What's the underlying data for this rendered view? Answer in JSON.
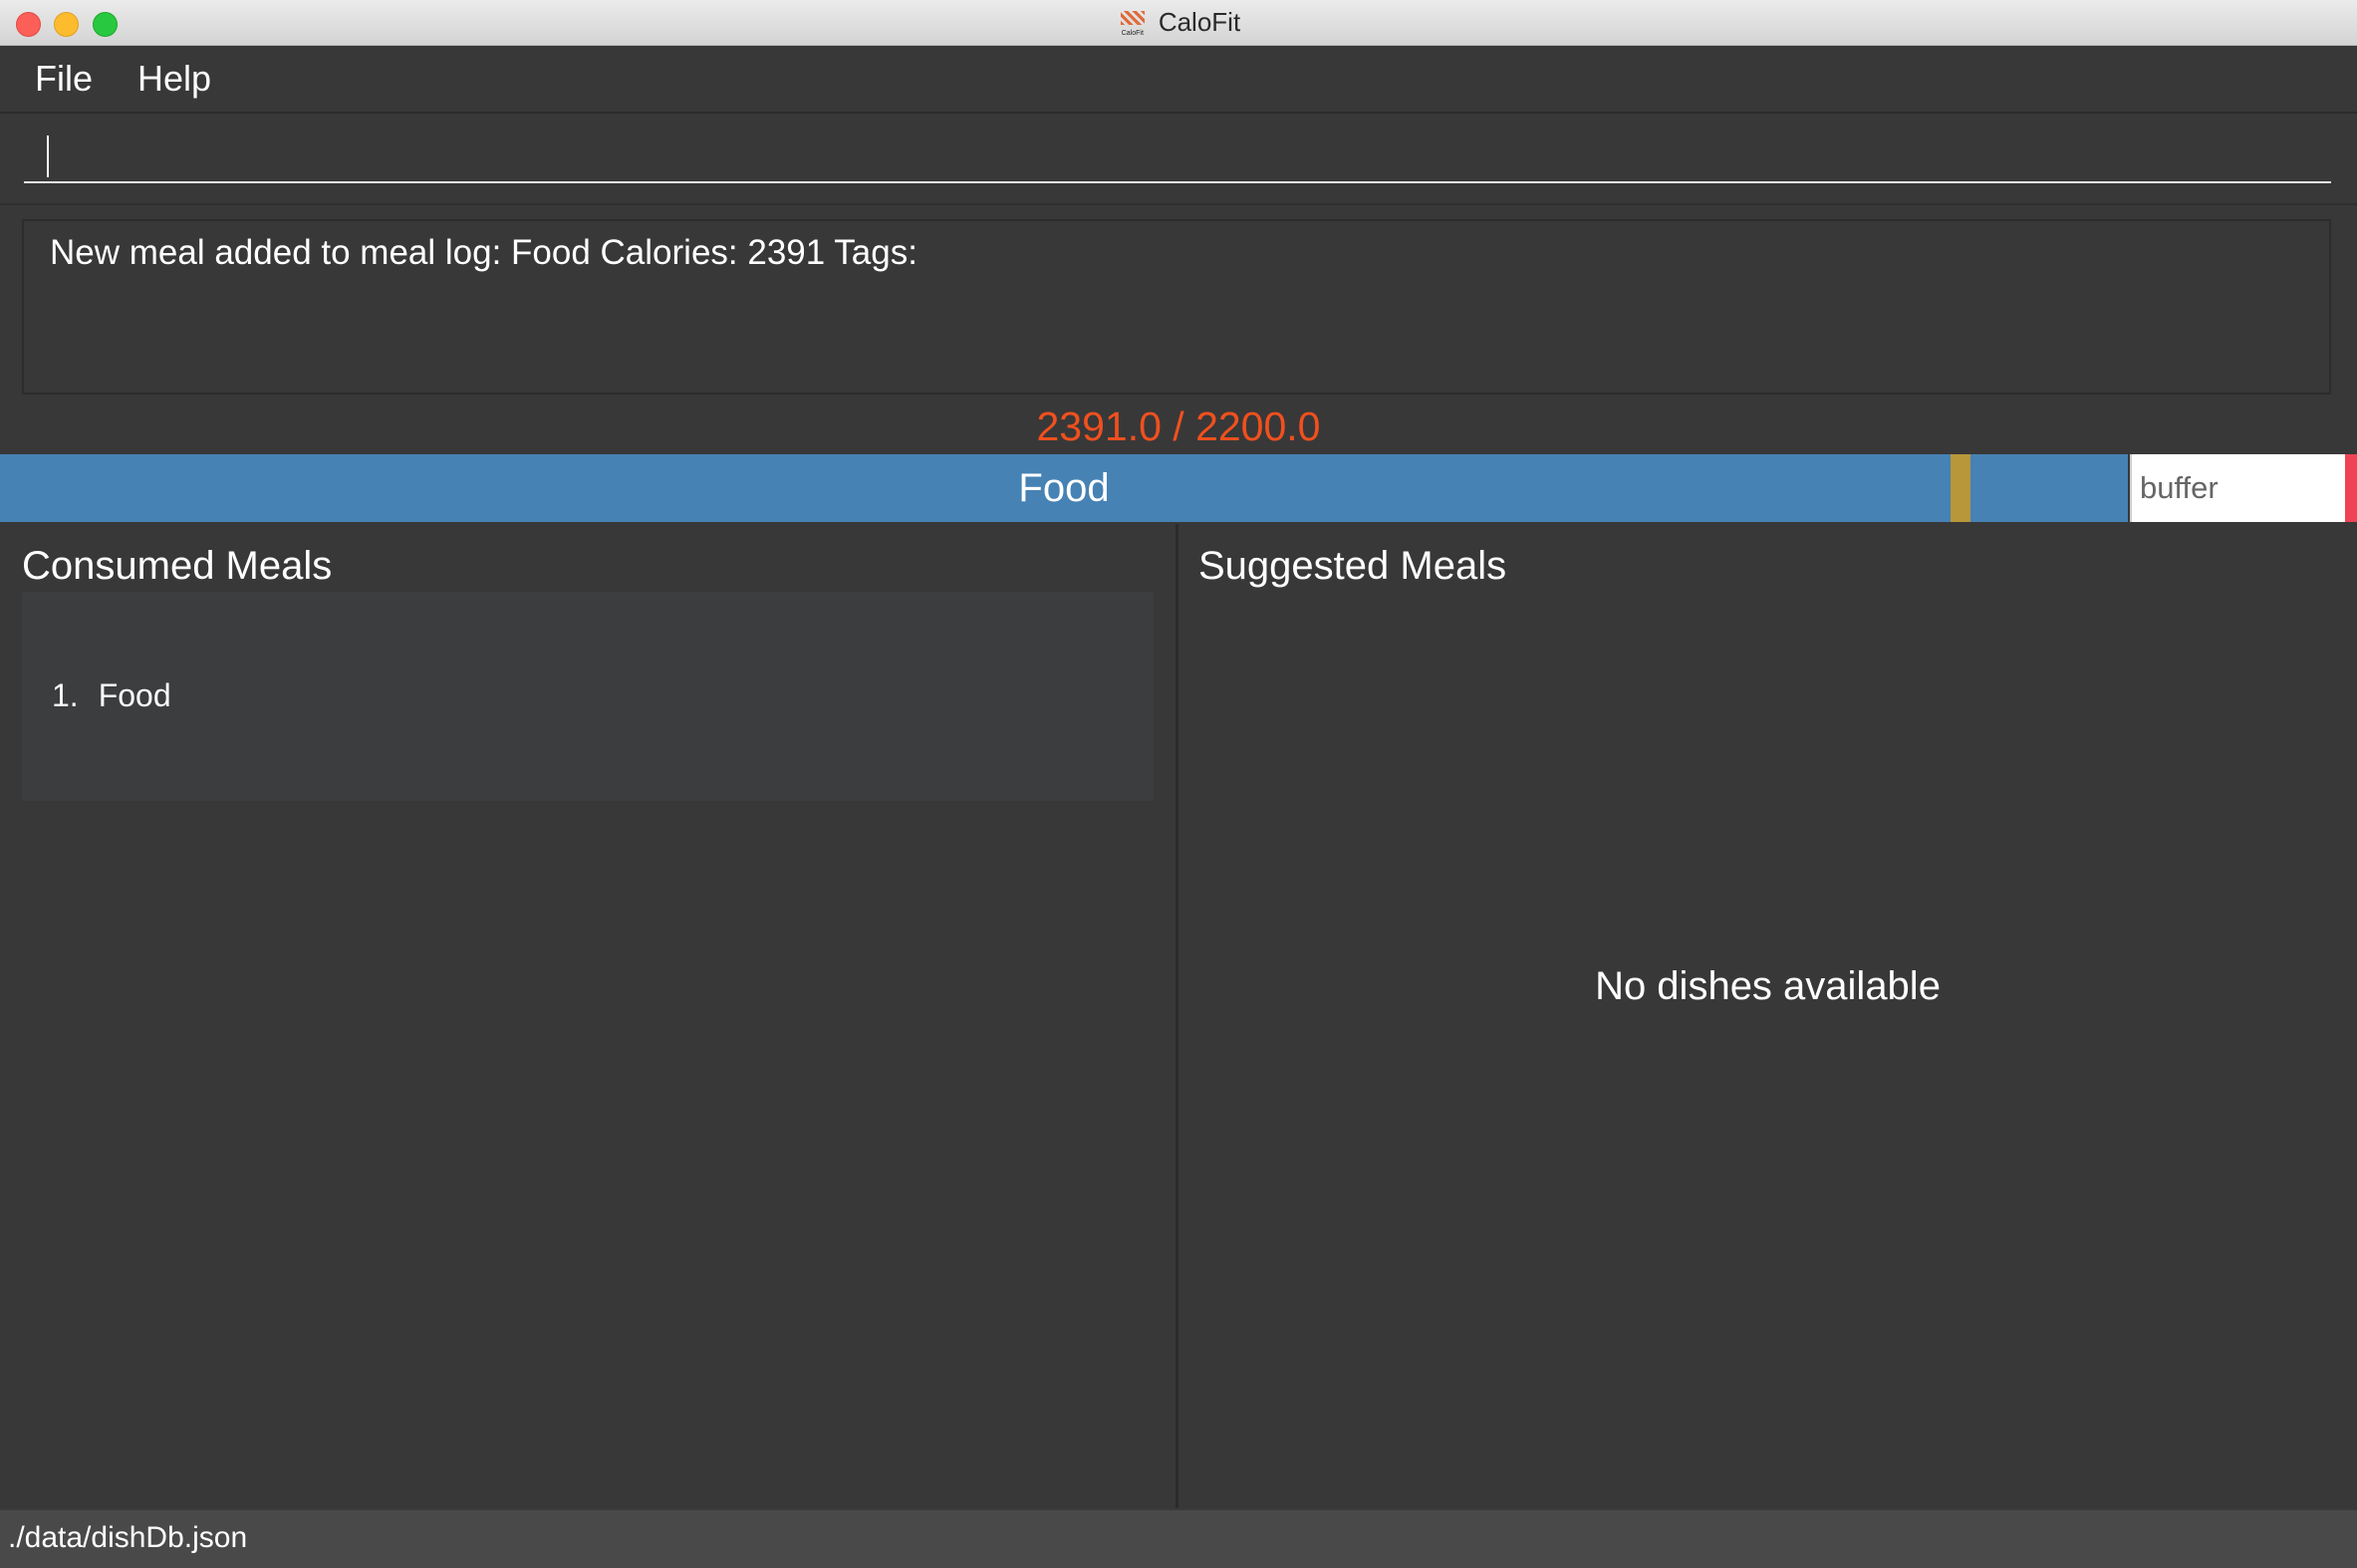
{
  "window": {
    "title": "CaloFit",
    "logo_text": "CaloFit"
  },
  "menu": {
    "items": [
      "File",
      "Help"
    ]
  },
  "command": {
    "value": "",
    "placeholder": ""
  },
  "result": {
    "message": "New meal added to meal log: Food Calories: 2391 Tags:"
  },
  "calories": {
    "display": "2391.0 / 2200.0",
    "consumed": 2391.0,
    "limit": 2200.0,
    "color": "#f0501e"
  },
  "calorie_bar": {
    "segments": [
      {
        "label": "Food",
        "color": "#4682b4"
      },
      {
        "label": "buffer",
        "color": "#ffffff"
      }
    ]
  },
  "consumed_meals": {
    "title": "Consumed Meals",
    "items": [
      {
        "index": "1.",
        "name": "Food"
      }
    ]
  },
  "suggested_meals": {
    "title": "Suggested Meals",
    "empty_text": "No dishes available"
  },
  "status_bar": {
    "path": "./data/dishDb.json"
  }
}
